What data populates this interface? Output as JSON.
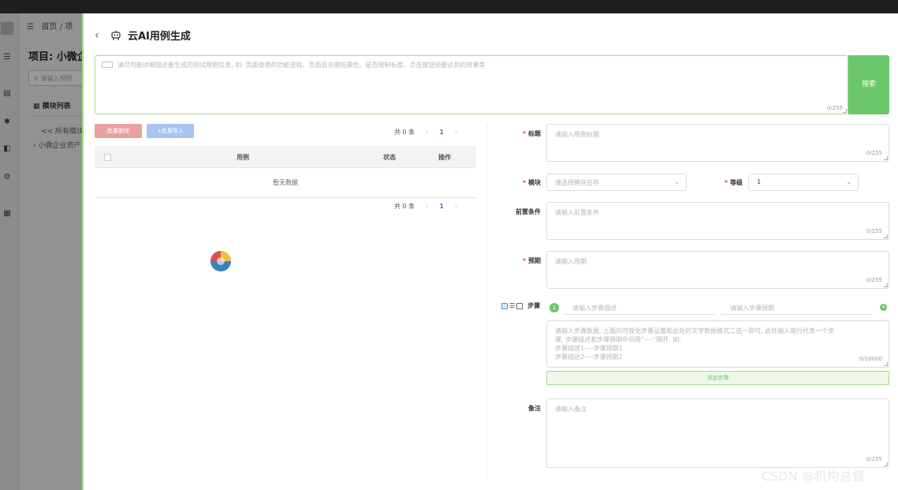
{
  "background": {
    "breadcrumb": "首页 / 项",
    "project_title": "项目: 小微企",
    "search_placeholder": "请输入用例",
    "module_list_title": "模块列表",
    "tree_all": "<< 所有模块",
    "tree_item": "小微企业资产"
  },
  "drawer": {
    "title": "云AI用例生成",
    "prompt_placeholder": "请尽可能详细描述要生成的测试用例信息, 如: 页面使用的功能流程、页面显示哪些属性、是否限制长度、点击按钮预要达到的效果等",
    "prompt_count": "0/255",
    "generate_label": "搜索"
  },
  "list": {
    "batch_delete_label": "批量删除",
    "batch_import_label": "+批量导入",
    "total_top": "共 0 条",
    "page_top": "1",
    "col_case": "用例",
    "col_status": "状态",
    "col_action": "操作",
    "empty_text": "暂无数据",
    "total_bottom": "共 0 条",
    "page_bottom": "1"
  },
  "form": {
    "title_label": "标题",
    "title_placeholder": "请输入用例标题",
    "title_count": "0/255",
    "module_label": "模块",
    "module_placeholder": "请选择模块名称",
    "level_label": "等级",
    "level_value": "1",
    "precondition_label": "前置条件",
    "precondition_placeholder": "请输入前置条件",
    "precondition_count": "0/255",
    "expected_label": "预期",
    "expected_placeholder": "请输入预期",
    "expected_count": "0/255",
    "steps_label": "步骤",
    "step_number": "1",
    "step_desc_placeholder": "请输入步骤描述",
    "step_expect_placeholder": "请输入步骤预期",
    "steps_text_placeholder_1": "请输入步骤数据, 上面的可视化步骤设置和此处的文字数据格式二选一即可, 此处输入每行代表一个步",
    "steps_text_placeholder_2": "骤, 步骤描述和步骤预期中间用\"----\"隔开, 如:",
    "steps_text_placeholder_3": "步骤描述1----步骤预期1",
    "steps_text_placeholder_4": "步骤描述2----步骤预期2",
    "steps_count": "0/10000",
    "add_step_label": "添加步骤",
    "remark_label": "备注",
    "remark_placeholder": "请输入备注",
    "remark_count": "0/255"
  },
  "watermark": "CSDN @机构总督",
  "colors": {
    "accent_green": "#6bc76b",
    "danger": "#e7a1a1",
    "primary_light": "#a7c4f5"
  }
}
